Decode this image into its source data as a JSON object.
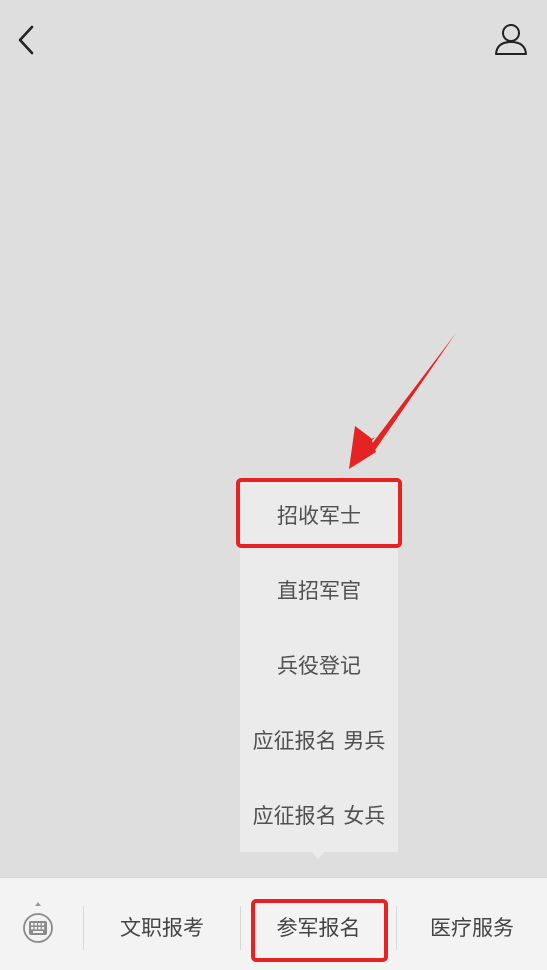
{
  "header": {
    "back_icon": "chevron-left-icon",
    "profile_icon": "user-icon"
  },
  "popup_menu": {
    "items": [
      {
        "label": "招收军士"
      },
      {
        "label": "直招军官"
      },
      {
        "label": "兵役登记"
      },
      {
        "label": "应征报名 男兵"
      },
      {
        "label": "应征报名 女兵"
      }
    ]
  },
  "bottom_menu": {
    "keyboard_icon": "keyboard-icon",
    "tabs": [
      {
        "label": "文职报考"
      },
      {
        "label": "参军报名"
      },
      {
        "label": "医疗服务"
      }
    ]
  },
  "colors": {
    "background": "#dedede",
    "popup_background": "#ebebeb",
    "bottom_bar": "#f3f3f3",
    "annotation_red": "#e62323"
  }
}
